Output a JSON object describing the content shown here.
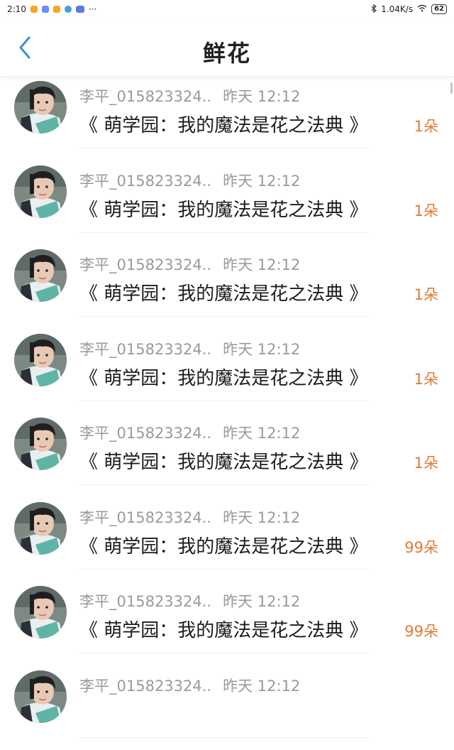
{
  "status_bar": {
    "time": "2:10",
    "more": "···",
    "network_speed": "1.04K/s",
    "battery": "62"
  },
  "header": {
    "title": "鲜花"
  },
  "colors": {
    "accent_back": "#3a8ee6",
    "count_orange": "#e07a38"
  },
  "rows": [
    {
      "user": "李平_015823324..",
      "time": "昨天 12:12",
      "book": "《 萌学园：我的魔法是花之法典 》",
      "count": "1朵"
    },
    {
      "user": "李平_015823324..",
      "time": "昨天 12:12",
      "book": "《 萌学园：我的魔法是花之法典 》",
      "count": "1朵"
    },
    {
      "user": "李平_015823324..",
      "time": "昨天 12:12",
      "book": "《 萌学园：我的魔法是花之法典 》",
      "count": "1朵"
    },
    {
      "user": "李平_015823324..",
      "time": "昨天 12:12",
      "book": "《 萌学园：我的魔法是花之法典 》",
      "count": "1朵"
    },
    {
      "user": "李平_015823324..",
      "time": "昨天 12:12",
      "book": "《 萌学园：我的魔法是花之法典 》",
      "count": "1朵"
    },
    {
      "user": "李平_015823324..",
      "time": "昨天 12:12",
      "book": "《 萌学园：我的魔法是花之法典 》",
      "count": "99朵"
    },
    {
      "user": "李平_015823324..",
      "time": "昨天 12:12",
      "book": "《 萌学园：我的魔法是花之法典 》",
      "count": "99朵"
    },
    {
      "user": "李平_015823324..",
      "time": "昨天 12:12",
      "book": "",
      "count": ""
    }
  ]
}
